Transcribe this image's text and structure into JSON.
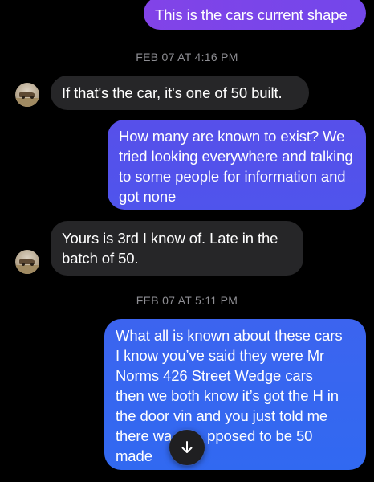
{
  "thread": {
    "messages": [
      {
        "direction": "outgoing",
        "text": "This is the cars current shape"
      },
      {
        "direction": "timestamp",
        "text": "FEB 07 AT 4:16 PM"
      },
      {
        "direction": "incoming",
        "text": "If that's the car, it's one of 50 built."
      },
      {
        "direction": "outgoing",
        "text": "How many are known to exist? We tried looking everywhere and talking to some people for information and got none"
      },
      {
        "direction": "incoming",
        "text": "Yours is 3rd I know of. Late in the batch of 50."
      },
      {
        "direction": "timestamp",
        "text": "FEB 07 AT 5:11 PM"
      },
      {
        "direction": "outgoing",
        "text_lines": [
          "What all is known about these cars",
          "I know you’ve said they were Mr",
          "Norms 426 Street Wedge cars",
          "then we both know it’s got the H in",
          "the door vin and you just told me",
          "there wa",
          "pposed to be 50",
          "made"
        ]
      }
    ]
  },
  "icons": {
    "avatar": "avatar-photo",
    "scroll_down": "arrow-down-icon"
  },
  "colors": {
    "background": "#000000",
    "incoming_bubble": "#262628",
    "outgoing_top": "#8243e8",
    "outgoing_mid": "#5452eb",
    "outgoing_bottom": "#3169f1",
    "timestamp": "#8e8e93"
  }
}
